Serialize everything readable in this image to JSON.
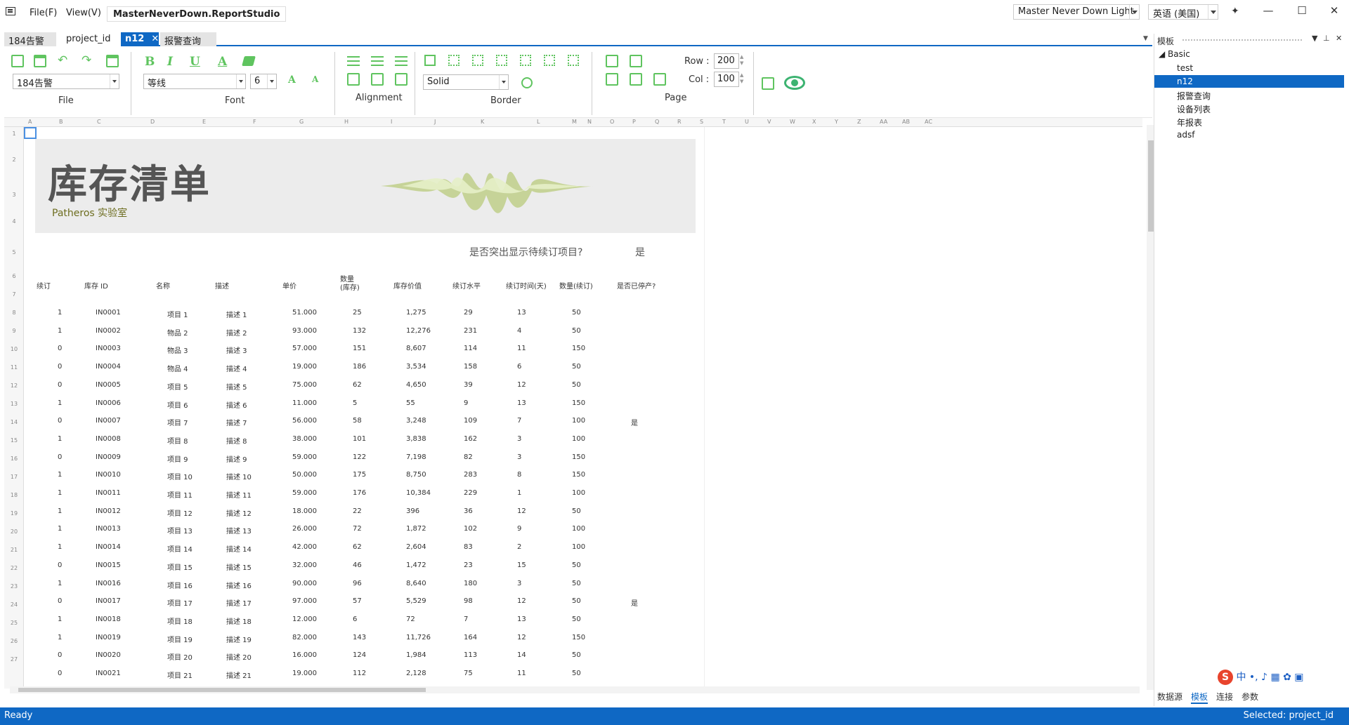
{
  "menu": {
    "file": "File(F)",
    "view": "View(V)"
  },
  "app_title": "MasterNeverDown.ReportStudio",
  "theme": "Master Never Down Light",
  "language": "英语 (美国)",
  "tabs": [
    {
      "label": "184告警"
    },
    {
      "label": "project_id"
    },
    {
      "label": "n12",
      "close": "✕"
    },
    {
      "label": "报警查询"
    }
  ],
  "ribbon": {
    "file_group": "File",
    "font_group": "Font",
    "align_group": "Alignment",
    "border_group": "Border",
    "page_group": "Page",
    "template_combo": "184告警",
    "font_combo": "等线",
    "font_size": "6",
    "border_style": "Solid",
    "row_label": "Row :",
    "row_value": "200",
    "col_label": "Col :",
    "col_value": "100",
    "bold": "B",
    "italic": "I",
    "underline": "U",
    "font_color": "A",
    "grow_font": "A",
    "shrink_font": "A"
  },
  "sheet": {
    "columns": [
      "A",
      "B",
      "C",
      "D",
      "E",
      "F",
      "G",
      "H",
      "I",
      "J",
      "K",
      "L",
      "M",
      "N",
      "O",
      "P",
      "Q",
      "R",
      "S",
      "T",
      "U",
      "V",
      "W",
      "X",
      "Y",
      "Z",
      "AA",
      "AB",
      "AC"
    ],
    "rows": [
      "1",
      "2",
      "3",
      "4",
      "5",
      "6",
      "7",
      "8",
      "9",
      "10",
      "11",
      "12",
      "13",
      "14",
      "15",
      "16",
      "17",
      "18",
      "19",
      "20",
      "21",
      "22",
      "23",
      "24",
      "25",
      "26",
      "27"
    ],
    "title": "库存清单",
    "subtitle": "Patheros 实验室",
    "question": "是否突出显示待续订项目?",
    "question_answer": "是",
    "headers": [
      "续订",
      "库存 ID",
      "名称",
      "描述",
      "单价",
      "数量\n(库存)",
      "库存价值",
      "续订水平",
      "续订时间(天)",
      "数量(续订)",
      "是否已停产?"
    ],
    "data": [
      [
        "1",
        "IN0001",
        "项目 1",
        "描述 1",
        "51.000",
        "25",
        "1,275",
        "29",
        "13",
        "50",
        ""
      ],
      [
        "1",
        "IN0002",
        "物品 2",
        "描述 2",
        "93.000",
        "132",
        "12,276",
        "231",
        "4",
        "50",
        ""
      ],
      [
        "0",
        "IN0003",
        "物品 3",
        "描述 3",
        "57.000",
        "151",
        "8,607",
        "114",
        "11",
        "150",
        ""
      ],
      [
        "0",
        "IN0004",
        "物品 4",
        "描述 4",
        "19.000",
        "186",
        "3,534",
        "158",
        "6",
        "50",
        ""
      ],
      [
        "0",
        "IN0005",
        "项目 5",
        "描述 5",
        "75.000",
        "62",
        "4,650",
        "39",
        "12",
        "50",
        ""
      ],
      [
        "1",
        "IN0006",
        "项目 6",
        "描述 6",
        "11.000",
        "5",
        "55",
        "9",
        "13",
        "150",
        ""
      ],
      [
        "0",
        "IN0007",
        "项目 7",
        "描述 7",
        "56.000",
        "58",
        "3,248",
        "109",
        "7",
        "100",
        "是"
      ],
      [
        "1",
        "IN0008",
        "项目 8",
        "描述 8",
        "38.000",
        "101",
        "3,838",
        "162",
        "3",
        "100",
        ""
      ],
      [
        "0",
        "IN0009",
        "项目 9",
        "描述 9",
        "59.000",
        "122",
        "7,198",
        "82",
        "3",
        "150",
        ""
      ],
      [
        "1",
        "IN0010",
        "项目 10",
        "描述 10",
        "50.000",
        "175",
        "8,750",
        "283",
        "8",
        "150",
        ""
      ],
      [
        "1",
        "IN0011",
        "项目 11",
        "描述 11",
        "59.000",
        "176",
        "10,384",
        "229",
        "1",
        "100",
        ""
      ],
      [
        "1",
        "IN0012",
        "项目 12",
        "描述 12",
        "18.000",
        "22",
        "396",
        "36",
        "12",
        "50",
        ""
      ],
      [
        "1",
        "IN0013",
        "项目 13",
        "描述 13",
        "26.000",
        "72",
        "1,872",
        "102",
        "9",
        "100",
        ""
      ],
      [
        "1",
        "IN0014",
        "项目 14",
        "描述 14",
        "42.000",
        "62",
        "2,604",
        "83",
        "2",
        "100",
        ""
      ],
      [
        "0",
        "IN0015",
        "项目 15",
        "描述 15",
        "32.000",
        "46",
        "1,472",
        "23",
        "15",
        "50",
        ""
      ],
      [
        "1",
        "IN0016",
        "项目 16",
        "描述 16",
        "90.000",
        "96",
        "8,640",
        "180",
        "3",
        "50",
        ""
      ],
      [
        "0",
        "IN0017",
        "项目 17",
        "描述 17",
        "97.000",
        "57",
        "5,529",
        "98",
        "12",
        "50",
        "是"
      ],
      [
        "1",
        "IN0018",
        "项目 18",
        "描述 18",
        "12.000",
        "6",
        "72",
        "7",
        "13",
        "50",
        ""
      ],
      [
        "1",
        "IN0019",
        "项目 19",
        "描述 19",
        "82.000",
        "143",
        "11,726",
        "164",
        "12",
        "150",
        ""
      ],
      [
        "0",
        "IN0020",
        "项目 20",
        "描述 20",
        "16.000",
        "124",
        "1,984",
        "113",
        "14",
        "50",
        ""
      ],
      [
        "0",
        "IN0021",
        "项目 21",
        "描述 21",
        "19.000",
        "112",
        "2,128",
        "75",
        "11",
        "50",
        ""
      ]
    ]
  },
  "panel": {
    "title": "模板",
    "root": "Basic",
    "items": [
      "test",
      "n12",
      "报警查询",
      "设备列表",
      "年报表",
      "adsf"
    ],
    "selected_index": 1,
    "bottom_tabs": [
      "数据源",
      "模板",
      "连接",
      "参数"
    ],
    "active_bottom_tab": 1,
    "ime": "中"
  },
  "status": {
    "left": "Ready",
    "right": "Selected: project_id"
  },
  "colors": {
    "accent": "#0f68c4",
    "icon_green": "#5fc45f"
  }
}
